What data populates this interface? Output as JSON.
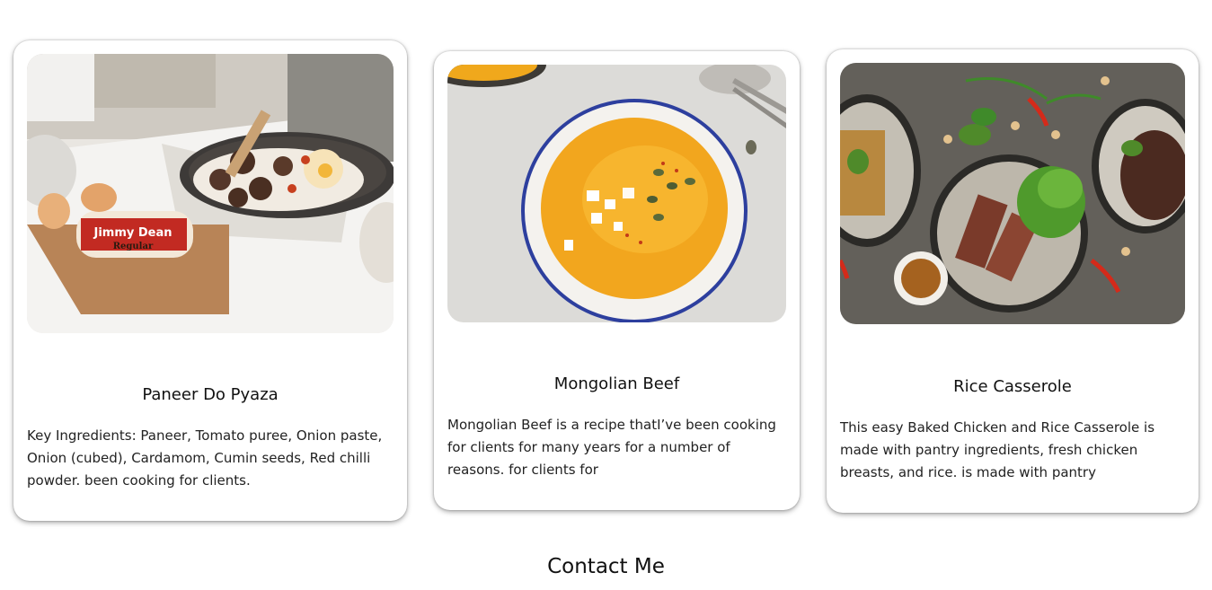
{
  "cards": [
    {
      "title": "Paneer Do Pyaza",
      "description": "Key Ingredients: Paneer, Tomato puree, Onion paste, Onion (cubed), Cardamom, Cumin seeds, Red chilli powder. been cooking for clients.",
      "image_label": "Jimmy Dean",
      "image_sublabel": "Regular"
    },
    {
      "title": "Mongolian Beef",
      "description": "Mongolian Beef is a recipe thatI’ve been cooking for clients for many years for a number of reasons. for clients for"
    },
    {
      "title": "Rice Casserole",
      "description": "This easy Baked Chicken and Rice Casserole is made with pantry ingredients, fresh chicken breasts, and rice. is made with pantry"
    }
  ],
  "contact": {
    "heading": "Contact Me"
  }
}
